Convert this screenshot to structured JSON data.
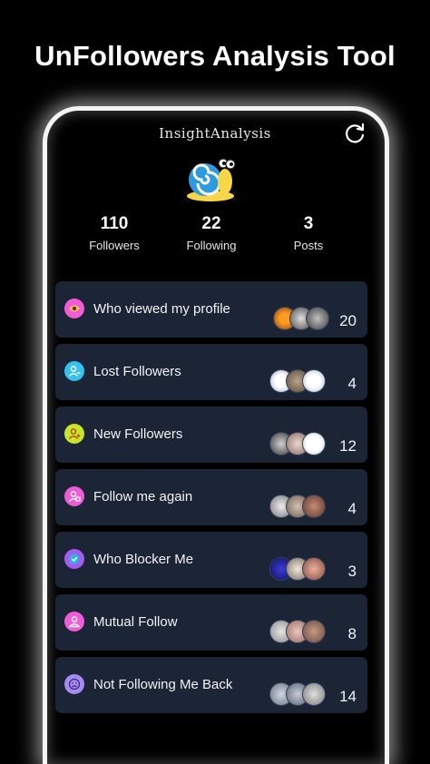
{
  "headline": "UnFollowers Analysis Tool",
  "app": {
    "name": "InsightAnalysis"
  },
  "icons": {
    "refresh": "refresh-icon",
    "avatar": "snail-avatar"
  },
  "stats": [
    {
      "value": "110",
      "label": "Followers"
    },
    {
      "value": "22",
      "label": "Following"
    },
    {
      "value": "3",
      "label": "Posts"
    }
  ],
  "colors": {
    "card_bg": "#1b2536",
    "icon_viewed": "#f25bd9",
    "icon_lost": "#35c2f0",
    "icon_new": "#c7e62b",
    "icon_again": "#ee5bd6",
    "icon_blocker": "#a35cf0",
    "icon_mutual": "#f05bdc",
    "icon_notback": "#a88bf2"
  },
  "cards": [
    {
      "title": "Who viewed my profile",
      "count": "20",
      "icon": "eye-icon"
    },
    {
      "title": "Lost Followers",
      "count": "4",
      "icon": "user-minus-icon"
    },
    {
      "title": "New Followers",
      "count": "12",
      "icon": "user-plus-icon"
    },
    {
      "title": "Follow me again",
      "count": "4",
      "icon": "user-return-icon"
    },
    {
      "title": "Who Blocker Me",
      "count": "3",
      "icon": "shield-check-icon"
    },
    {
      "title": "Mutual Follow",
      "count": "8",
      "icon": "mutual-user-icon"
    },
    {
      "title": "Not Following Me Back",
      "count": "14",
      "icon": "sad-face-icon"
    }
  ]
}
